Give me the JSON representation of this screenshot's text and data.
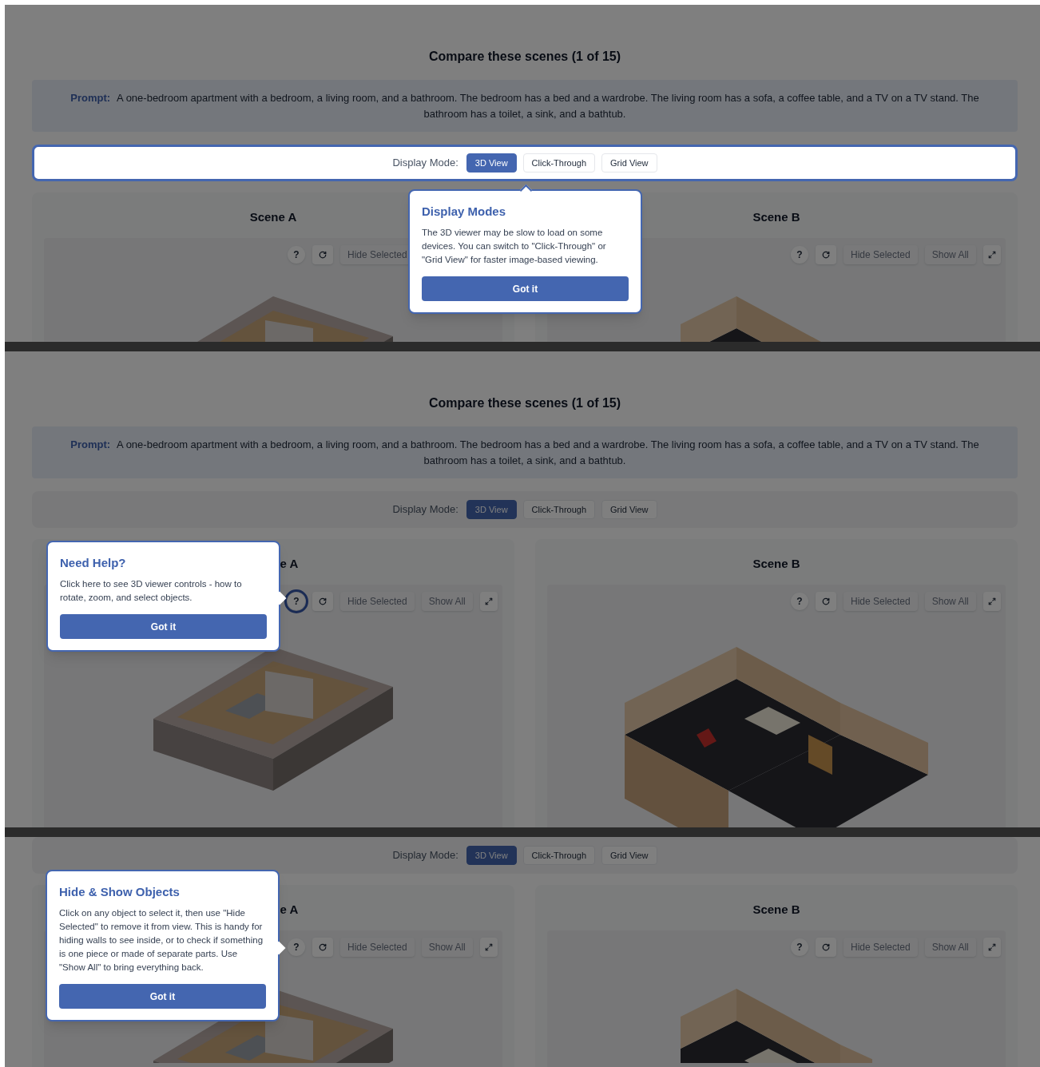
{
  "panels": [
    {
      "title": "Compare these scenes (1 of 15)",
      "prompt": {
        "label": "Prompt:",
        "text": "A one-bedroom apartment with a bedroom, a living room, and a bathroom. The bedroom has a bed and a wardrobe. The living room has a sofa, a coffee table, and a TV on a TV stand. The bathroom has a toilet, a sink, and a bathtub."
      },
      "display_mode": {
        "label": "Display Mode:",
        "highlighted": true,
        "options": [
          {
            "label": "3D View",
            "selected": true
          },
          {
            "label": "Click-Through",
            "selected": false
          },
          {
            "label": "Grid View",
            "selected": false
          }
        ]
      },
      "scenes": [
        {
          "title": "Scene A",
          "toolbar": [
            {
              "kind": "help",
              "label": "?",
              "highlighted": false
            },
            {
              "kind": "reset"
            },
            {
              "kind": "text",
              "label": "Hide Selected"
            }
          ]
        },
        {
          "title": "Scene B",
          "toolbar": [
            {
              "kind": "help",
              "label": "?",
              "highlighted": false
            },
            {
              "kind": "reset"
            },
            {
              "kind": "text",
              "label": "Hide Selected"
            },
            {
              "kind": "text",
              "label": "Show All"
            },
            {
              "kind": "expand"
            }
          ]
        }
      ],
      "tooltip": {
        "kind": "top",
        "title": "Display Modes",
        "text": "The 3D viewer may be slow to load on some devices. You can switch to \"Click-Through\" or \"Grid View\" for faster image-based viewing.",
        "button": "Got it"
      }
    },
    {
      "title": "Compare these scenes (1 of 15)",
      "prompt": {
        "label": "Prompt:",
        "text": "A one-bedroom apartment with a bedroom, a living room, and a bathroom. The bedroom has a bed and a wardrobe. The living room has a sofa, a coffee table, and a TV on a TV stand. The bathroom has a toilet, a sink, and a bathtub."
      },
      "display_mode": {
        "label": "Display Mode:",
        "highlighted": false,
        "options": [
          {
            "label": "3D View",
            "selected": true
          },
          {
            "label": "Click-Through",
            "selected": false
          },
          {
            "label": "Grid View",
            "selected": false
          }
        ]
      },
      "scenes": [
        {
          "title": "e A",
          "toolbar": [
            {
              "kind": "help",
              "label": "?",
              "highlighted": true
            },
            {
              "kind": "reset"
            },
            {
              "kind": "text",
              "label": "Hide Selected"
            },
            {
              "kind": "text",
              "label": "Show All"
            },
            {
              "kind": "expand"
            }
          ]
        },
        {
          "title": "Scene B",
          "toolbar": [
            {
              "kind": "help",
              "label": "?",
              "highlighted": false
            },
            {
              "kind": "reset"
            },
            {
              "kind": "text",
              "label": "Hide Selected"
            },
            {
              "kind": "text",
              "label": "Show All"
            },
            {
              "kind": "expand"
            }
          ]
        }
      ],
      "tooltip": {
        "kind": "right",
        "title": "Need Help?",
        "text": "Click here to see 3D viewer controls - how to rotate, zoom, and select objects.",
        "button": "Got it"
      }
    },
    {
      "display_mode": {
        "label": "Display Mode:",
        "highlighted": false,
        "options": [
          {
            "label": "3D View",
            "selected": true
          },
          {
            "label": "Click-Through",
            "selected": false
          },
          {
            "label": "Grid View",
            "selected": false
          }
        ]
      },
      "scenes": [
        {
          "title": "e A",
          "toolbar": [
            {
              "kind": "help",
              "label": "?",
              "highlighted": false
            },
            {
              "kind": "reset"
            },
            {
              "kind": "text",
              "label": "Hide Selected"
            },
            {
              "kind": "text",
              "label": "Show All"
            },
            {
              "kind": "expand"
            }
          ]
        },
        {
          "title": "Scene B",
          "toolbar": [
            {
              "kind": "help",
              "label": "?",
              "highlighted": false
            },
            {
              "kind": "reset"
            },
            {
              "kind": "text",
              "label": "Hide Selected"
            },
            {
              "kind": "text",
              "label": "Show All"
            },
            {
              "kind": "expand"
            }
          ]
        }
      ],
      "tooltip": {
        "kind": "right",
        "title": "Hide & Show Objects",
        "text": "Click on any object to select it, then use \"Hide Selected\" to remove it from view. This is handy for hiding walls to see inside, or to check if something is one piece or made of separate parts. Use \"Show All\" to bring everything back.",
        "button": "Got it"
      }
    }
  ]
}
